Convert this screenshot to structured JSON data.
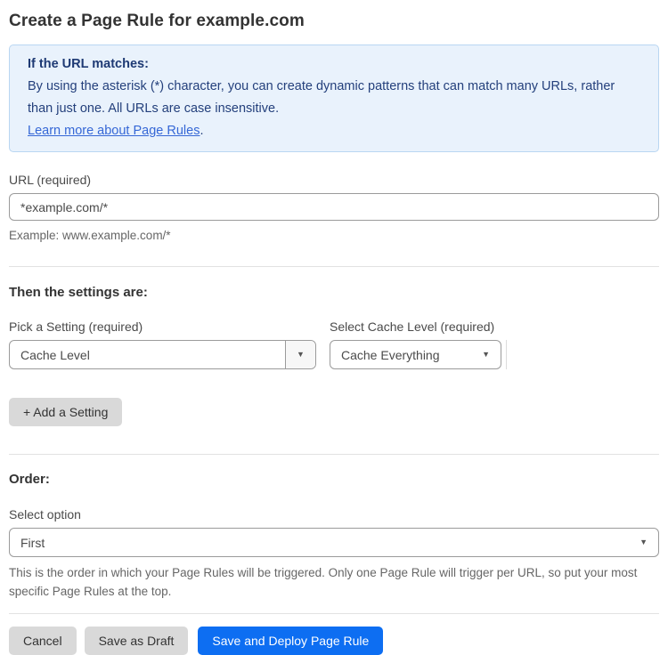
{
  "page": {
    "title": "Create a Page Rule for example.com"
  },
  "info_box": {
    "heading": "If the URL matches:",
    "body": "By using the asterisk (*) character, you can create dynamic patterns that can match many URLs, rather than just one. All URLs are case insensitive.",
    "link": "Learn more about Page Rules",
    "link_suffix": "."
  },
  "url_field": {
    "label": "URL (required)",
    "value": "*example.com/*",
    "helper": "Example: www.example.com/*"
  },
  "settings_section": {
    "heading": "Then the settings are:",
    "setting_picker": {
      "label": "Pick a Setting (required)",
      "value": "Cache Level"
    },
    "cache_level": {
      "label": "Select Cache Level (required)",
      "value": "Cache Everything"
    },
    "add_button_label": "+ Add a Setting"
  },
  "order_section": {
    "heading": "Order:",
    "label": "Select option",
    "value": "First",
    "helper": "This is the order in which your Page Rules will be triggered. Only one Page Rule will trigger per URL, so put your most specific Page Rules at the top."
  },
  "actions": {
    "cancel_label": "Cancel",
    "save_draft_label": "Save as Draft",
    "save_deploy_label": "Save and Deploy Page Rule"
  },
  "icons": {
    "dropdown_arrow": "▼"
  },
  "colors": {
    "accent_blue": "#0d6ef2",
    "info_bg": "#e9f2fc",
    "info_border": "#b9d6f2",
    "info_text": "#24407c",
    "link_blue": "#3567d6",
    "button_gray": "#d9d9d9"
  }
}
